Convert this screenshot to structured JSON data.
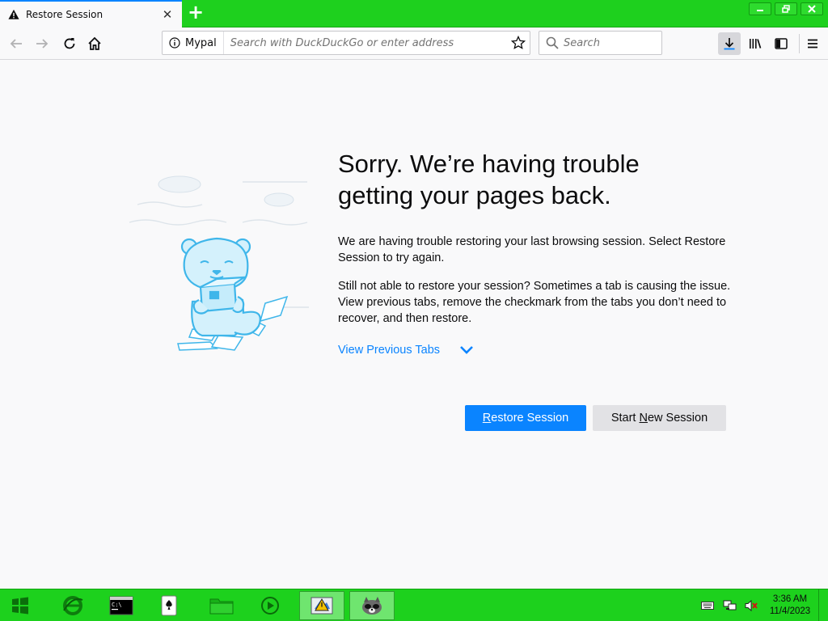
{
  "tab": {
    "title": "Restore Session"
  },
  "toolbar": {
    "site_label": "Mypal",
    "url_placeholder": "Search with DuckDuckGo or enter address",
    "search_placeholder": "Search"
  },
  "content": {
    "heading_line1": "Sorry. We’re having trouble",
    "heading_line2": "getting your pages back.",
    "paragraph1": "We are having trouble restoring your last browsing session. Select Restore Session to try again.",
    "paragraph2": "Still not able to restore your session? Sometimes a tab is causing the issue. View previous tabs, remove the checkmark from the tabs you don’t need to recover, and then restore.",
    "view_tabs_label": "View Previous Tabs",
    "restore_pre": "",
    "restore_key": "R",
    "restore_post": "estore Session",
    "new_pre": "Start ",
    "new_key": "N",
    "new_post": "ew Session"
  },
  "clock": {
    "time": "3:36 AM",
    "date": "11/4/2023"
  },
  "colors": {
    "accent": "#0a84ff",
    "chrome": "#1ed01e",
    "taskbar": "#1dd11d"
  },
  "icons": [
    "warning-icon",
    "close-icon",
    "plus-icon",
    "minimize-icon",
    "restore-icon",
    "window-close-icon",
    "back-icon",
    "forward-icon",
    "reload-icon",
    "home-icon",
    "info-icon",
    "star-icon",
    "magnifier-icon",
    "download-icon",
    "library-icon",
    "sidebar-icon",
    "menu-icon",
    "start-icon",
    "ie-icon",
    "console-icon",
    "solitaire-icon",
    "folder-icon",
    "media-icon",
    "mypal-icon",
    "tray-keyboard-icon",
    "tray-network-icon",
    "tray-volume-icon"
  ]
}
